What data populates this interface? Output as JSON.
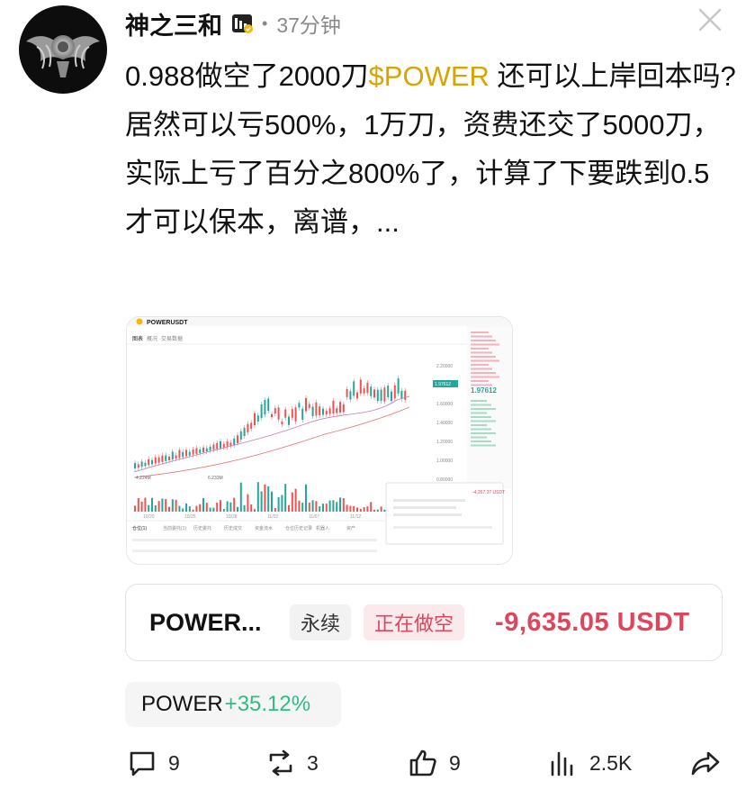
{
  "post": {
    "username": "神之三和",
    "time_ago": "37分钟",
    "dot": "•",
    "text_line1_prefix": "0.988做空了2000刀",
    "cashtag": "$POWER",
    "text_line1_suffix": " 还可以上岸回本吗?",
    "text_line2": "居然可以亏500%，1万刀，资费还交了5000刀，实际上亏了百分之800%了，计算了下要跌到0.5才可以保本，离谱，..."
  },
  "screenshot": {
    "symbol": "POWERUSDT",
    "tabs": [
      "图表",
      "概况",
      "交易数据"
    ],
    "price_labels": [
      "2.20000",
      "1.80000",
      "1.60000",
      "1.40000",
      "1.20000",
      "1.00000",
      "0.80000",
      "0.60000"
    ],
    "current_price": "1.97612",
    "pnl_popup": "-4,267.37 USDT",
    "bottom_tabs": [
      "仓位(1)",
      "当前委托(1)",
      "历史委托",
      "历史成交",
      "资金流水",
      "仓位历史记录",
      "机器人",
      "资产"
    ],
    "volume_label": "4.224M",
    "volume_label2": "6.233M",
    "dates": [
      "10/20",
      "10/25",
      "10/28",
      "11/02",
      "11/07",
      "11/12",
      "11/17"
    ]
  },
  "position": {
    "symbol": "POWER...",
    "tag_perp": "永续",
    "tag_side": "正在做空",
    "pnl": "-9,635.05 USDT"
  },
  "ticker": {
    "symbol": "POWER",
    "change": "+35.12%"
  },
  "actions": {
    "comments": "9",
    "reposts": "3",
    "likes": "9",
    "views": "2.5K"
  },
  "colors": {
    "cashtag": "#d9a300",
    "negative": "#e0455c",
    "positive": "#2ebd85",
    "candle_up": "#26a69a",
    "candle_down": "#ef5350"
  }
}
